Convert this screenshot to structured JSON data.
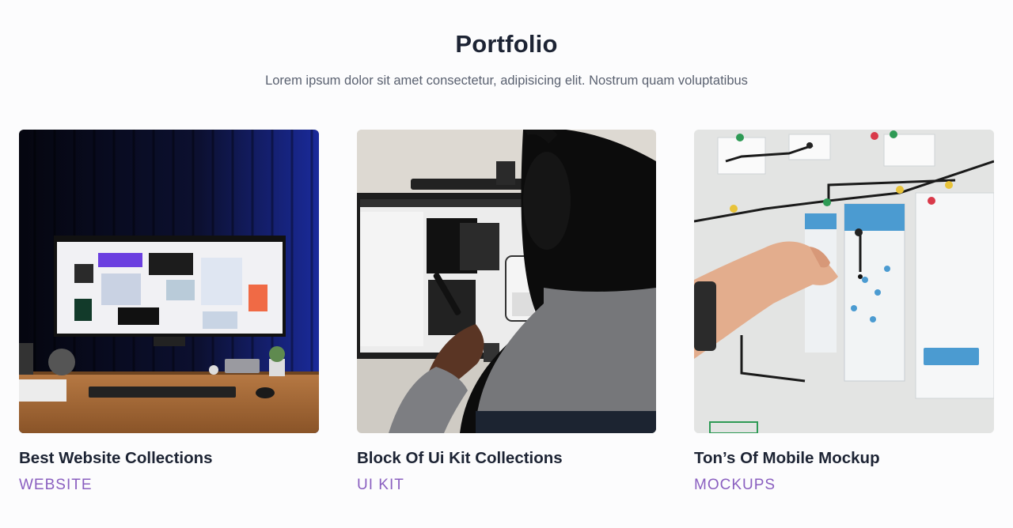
{
  "portfolio": {
    "title": "Portfolio",
    "subtitle": "Lorem ipsum dolor sit amet consectetur, adipisicing elit. Nostrum quam voluptatibus"
  },
  "cards": [
    {
      "title": "Best Website Collections",
      "tag": "WEBSITE"
    },
    {
      "title": "Block Of Ui Kit Collections",
      "tag": "UI KIT"
    },
    {
      "title": "Ton’s Of Mobile Mockup",
      "tag": "MOCKUPS"
    }
  ],
  "colors": {
    "heading": "#1d2434",
    "subtitle": "#5a6170",
    "tag": "#8a5fc0",
    "background": "#fcfcfd"
  }
}
